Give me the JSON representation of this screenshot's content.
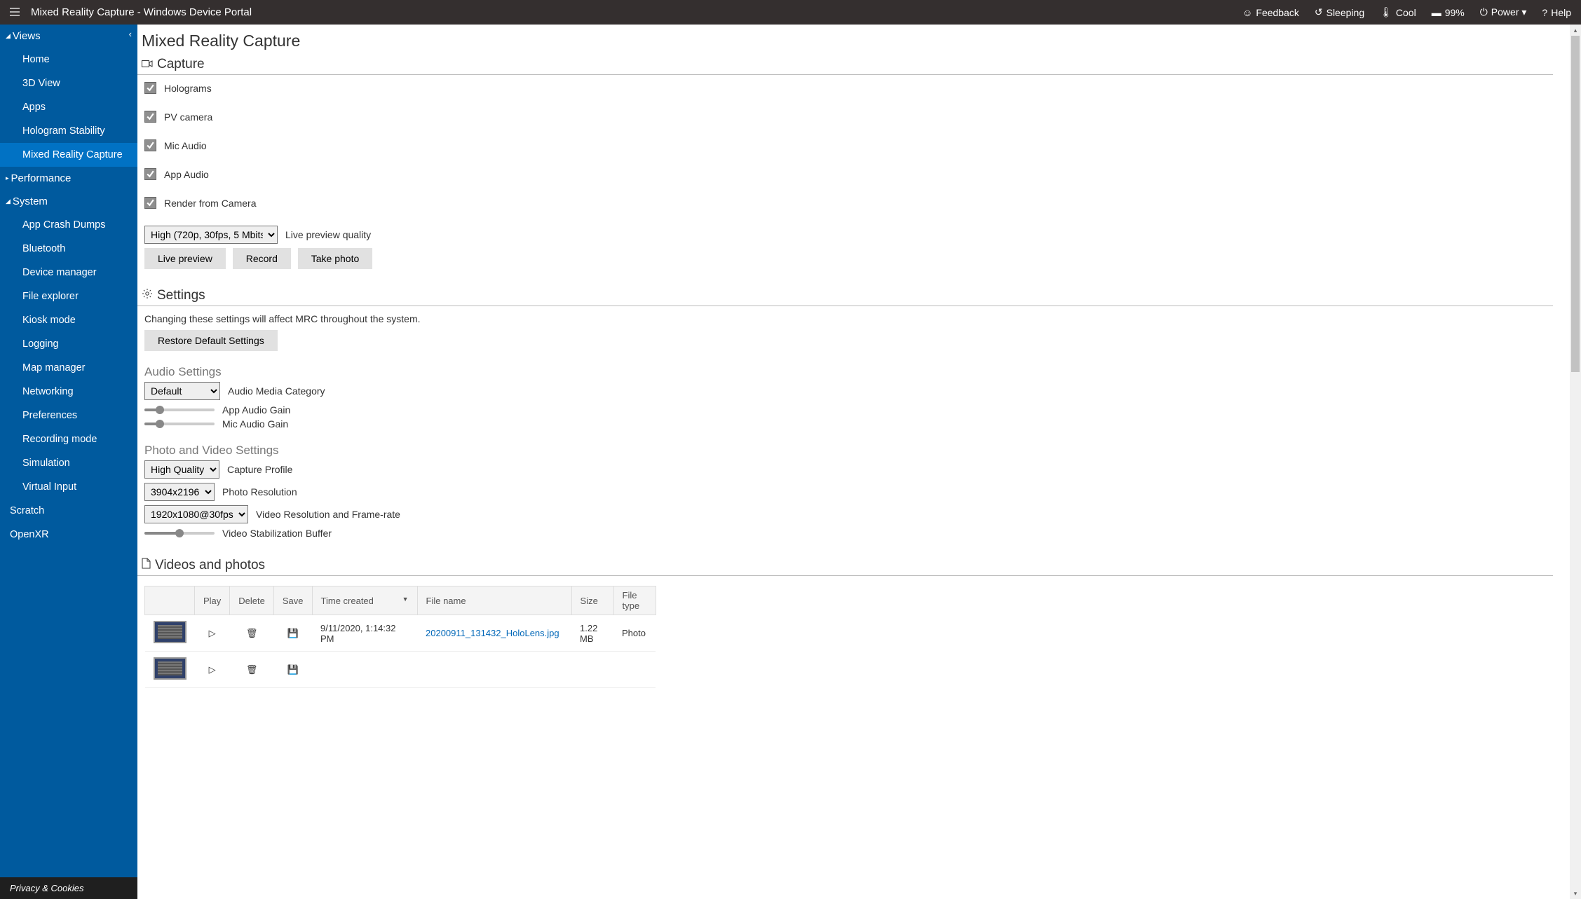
{
  "topbar": {
    "title": "Mixed Reality Capture - Windows Device Portal",
    "feedback": "Feedback",
    "sleeping": "Sleeping",
    "cool": "Cool",
    "battery": "99%",
    "power": "Power ▾",
    "help": "Help"
  },
  "sidebar": {
    "views_label": "Views",
    "views": [
      "Home",
      "3D View",
      "Apps",
      "Hologram Stability",
      "Mixed Reality Capture"
    ],
    "performance_label": "Performance",
    "system_label": "System",
    "system": [
      "App Crash Dumps",
      "Bluetooth",
      "Device manager",
      "File explorer",
      "Kiosk mode",
      "Logging",
      "Map manager",
      "Networking",
      "Preferences",
      "Recording mode",
      "Simulation",
      "Virtual Input"
    ],
    "scratch": "Scratch",
    "openxr": "OpenXR",
    "footer": "Privacy & Cookies"
  },
  "page": {
    "title": "Mixed Reality Capture",
    "capture": {
      "header": "Capture",
      "holograms": "Holograms",
      "pv_camera": "PV camera",
      "mic_audio": "Mic Audio",
      "app_audio": "App Audio",
      "render_from_camera": "Render from Camera",
      "quality_selected": "High (720p, 30fps, 5 Mbits)",
      "quality_label": "Live preview quality",
      "btn_live_preview": "Live preview",
      "btn_record": "Record",
      "btn_take_photo": "Take photo"
    },
    "settings": {
      "header": "Settings",
      "note": "Changing these settings will affect MRC throughout the system.",
      "btn_restore": "Restore Default Settings",
      "audio_header": "Audio Settings",
      "audio_category_selected": "Default",
      "audio_category_label": "Audio Media Category",
      "app_audio_gain": "App Audio Gain",
      "mic_audio_gain": "Mic Audio Gain",
      "pv_header": "Photo and Video Settings",
      "capture_profile_selected": "High Quality",
      "capture_profile_label": "Capture Profile",
      "photo_res_selected": "3904x2196",
      "photo_res_label": "Photo Resolution",
      "video_res_selected": "1920x1080@30fps",
      "video_res_label": "Video Resolution and Frame-rate",
      "stabilization_label": "Video Stabilization Buffer"
    },
    "files": {
      "header": "Videos and photos",
      "col_play": "Play",
      "col_delete": "Delete",
      "col_save": "Save",
      "col_time": "Time created",
      "col_filename": "File name",
      "col_size": "Size",
      "col_filetype": "File type",
      "rows": [
        {
          "time": "9/11/2020, 1:14:32 PM",
          "name": "20200911_131432_HoloLens.jpg",
          "size": "1.22 MB",
          "type": "Photo"
        }
      ]
    }
  }
}
